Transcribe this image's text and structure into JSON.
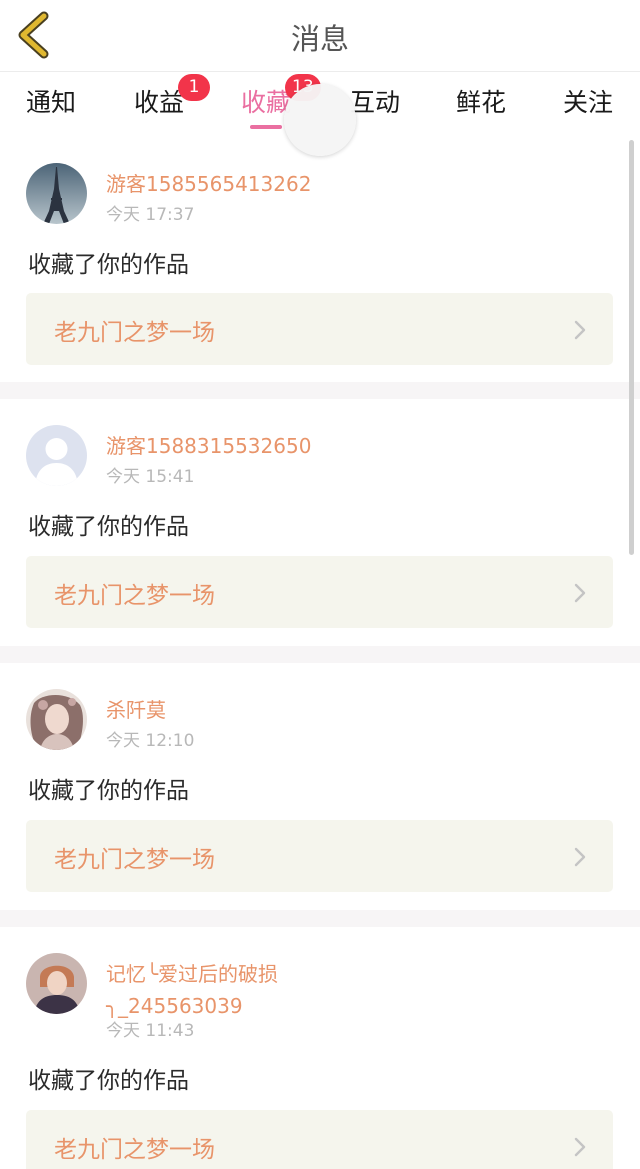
{
  "header": {
    "title": "消息",
    "back_icon": "chevron-left-icon",
    "accent_color": "#e0b830"
  },
  "tabs": [
    {
      "label": "通知",
      "badge": null,
      "active": false
    },
    {
      "label": "收益",
      "badge": "1",
      "active": false
    },
    {
      "label": "收藏",
      "badge": "13",
      "active": true
    },
    {
      "label": "互动",
      "badge": null,
      "active": false
    },
    {
      "label": "鲜花",
      "badge": null,
      "active": false
    },
    {
      "label": "关注",
      "badge": null,
      "active": false
    }
  ],
  "colors": {
    "active_tab": "#ea6fa1",
    "badge": "#f2344a",
    "username": "#e8946a",
    "work_title": "#e8946a",
    "work_box_bg": "#f5f5ed"
  },
  "messages": [
    {
      "username": "游客1585565413262",
      "time": "今天 17:37",
      "action": "收藏了你的作品",
      "work_title": "老九门之梦一场",
      "avatar": "eiffel-tower-avatar"
    },
    {
      "username": "游客1588315532650",
      "time": "今天 15:41",
      "action": "收藏了你的作品",
      "work_title": "老九门之梦一场",
      "avatar": "default-user-avatar"
    },
    {
      "username": "杀阡莫",
      "time": "今天 12:10",
      "action": "收藏了你的作品",
      "work_title": "老九门之梦一场",
      "avatar": "character-avatar"
    },
    {
      "username": "记忆╰爱过后的破损╮_245563039",
      "time": "今天 11:43",
      "action": "收藏了你的作品",
      "work_title": "老九门之梦一场",
      "avatar": "person-photo-avatar"
    }
  ]
}
